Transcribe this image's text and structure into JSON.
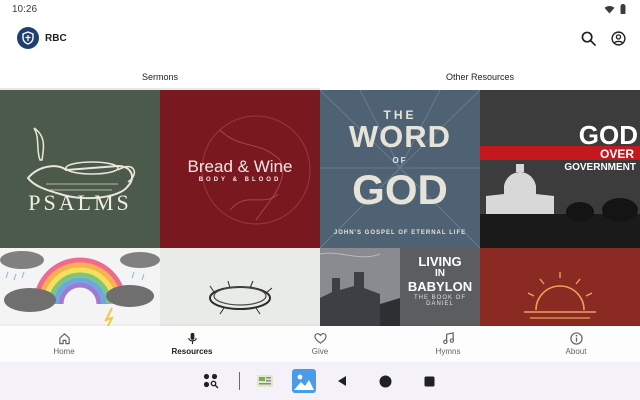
{
  "status_bar": {
    "time": "10:26",
    "wifi_icon": "wifi-icon",
    "battery_icon": "battery-icon"
  },
  "app_bar": {
    "title": "RBC",
    "logo_icon": "shield-logo-icon",
    "search_icon": "search-icon",
    "account_icon": "account-circle-icon"
  },
  "tabs": [
    {
      "label": "Sermons",
      "active": true
    },
    {
      "label": "Other Resources",
      "active": false
    }
  ],
  "sermon_series": [
    {
      "title": "PSALMS",
      "bg": "#4b5a4b"
    },
    {
      "title": "Bread & Wine",
      "subtitle": "BODY & BLOOD",
      "bg": "#7a1820"
    },
    {
      "title_lines": [
        "THE",
        "WORD",
        "OF",
        "GOD"
      ],
      "subtitle": "JOHN'S GOSPEL OF ETERNAL LIFE",
      "bg": "#4f6274"
    },
    {
      "title_lines": [
        "GOD",
        "OVER",
        "GOVERNMENT"
      ],
      "bg": "#2a2a2a",
      "accent": "#c5171e"
    },
    {
      "title": "",
      "bg": "#f4f4f4"
    },
    {
      "title": "",
      "bg": "#e9ebe7"
    },
    {
      "title_lines": [
        "LIVING",
        "IN",
        "BABYLON"
      ],
      "subtitle": "THE BOOK OF DANIEL",
      "bg": "#5c5d61"
    },
    {
      "title": "",
      "bg": "#8a2a22"
    }
  ],
  "bottom_nav": [
    {
      "label": "Home",
      "icon": "home-icon",
      "active": false
    },
    {
      "label": "Resources",
      "icon": "microphone-icon",
      "active": true
    },
    {
      "label": "Give",
      "icon": "heart-icon",
      "active": false
    },
    {
      "label": "Hymns",
      "icon": "music-note-icon",
      "active": false
    },
    {
      "label": "About",
      "icon": "info-icon",
      "active": false
    }
  ],
  "system_nav": {
    "apps_icon": "app-drawer-icon",
    "back_icon": "back-icon",
    "home_icon": "home-circle-icon",
    "recents_icon": "recents-icon"
  },
  "colors": {
    "brand": "#1f3f6e",
    "red": "#c5171e",
    "nav_bg": "#f4f1f8"
  }
}
